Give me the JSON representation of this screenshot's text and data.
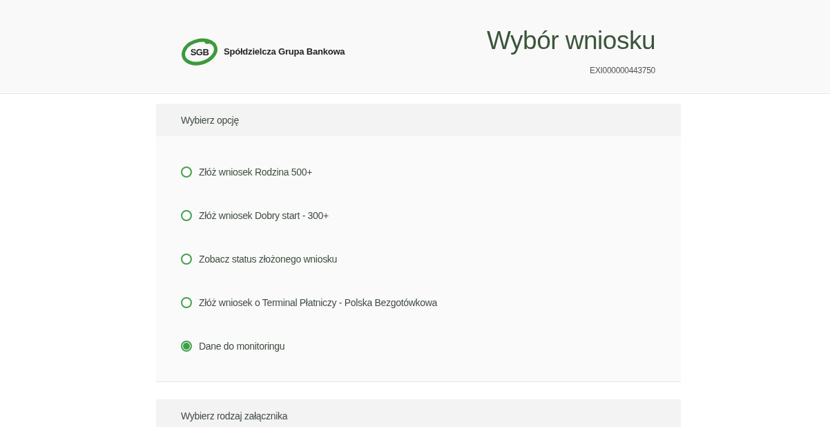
{
  "header": {
    "logo": {
      "mark": "SGB",
      "name": "Spółdzielcza Grupa Bankowa"
    },
    "title": "Wybór wniosku",
    "reference": "EXI000000443750"
  },
  "sections": [
    {
      "title": "Wybierz opcję",
      "options": [
        {
          "label": "Złóż wniosek Rodzina 500+",
          "selected": false
        },
        {
          "label": "Złóż wniosek Dobry start - 300+",
          "selected": false
        },
        {
          "label": "Zobacz status złożonego wniosku",
          "selected": false
        },
        {
          "label": "Złóż wniosek o Terminal Płatniczy - Polska Bezgotówkowa",
          "selected": false
        },
        {
          "label": "Dane do monitoringu",
          "selected": true
        }
      ]
    },
    {
      "title": "Wybierz rodzaj załącznika"
    }
  ]
}
